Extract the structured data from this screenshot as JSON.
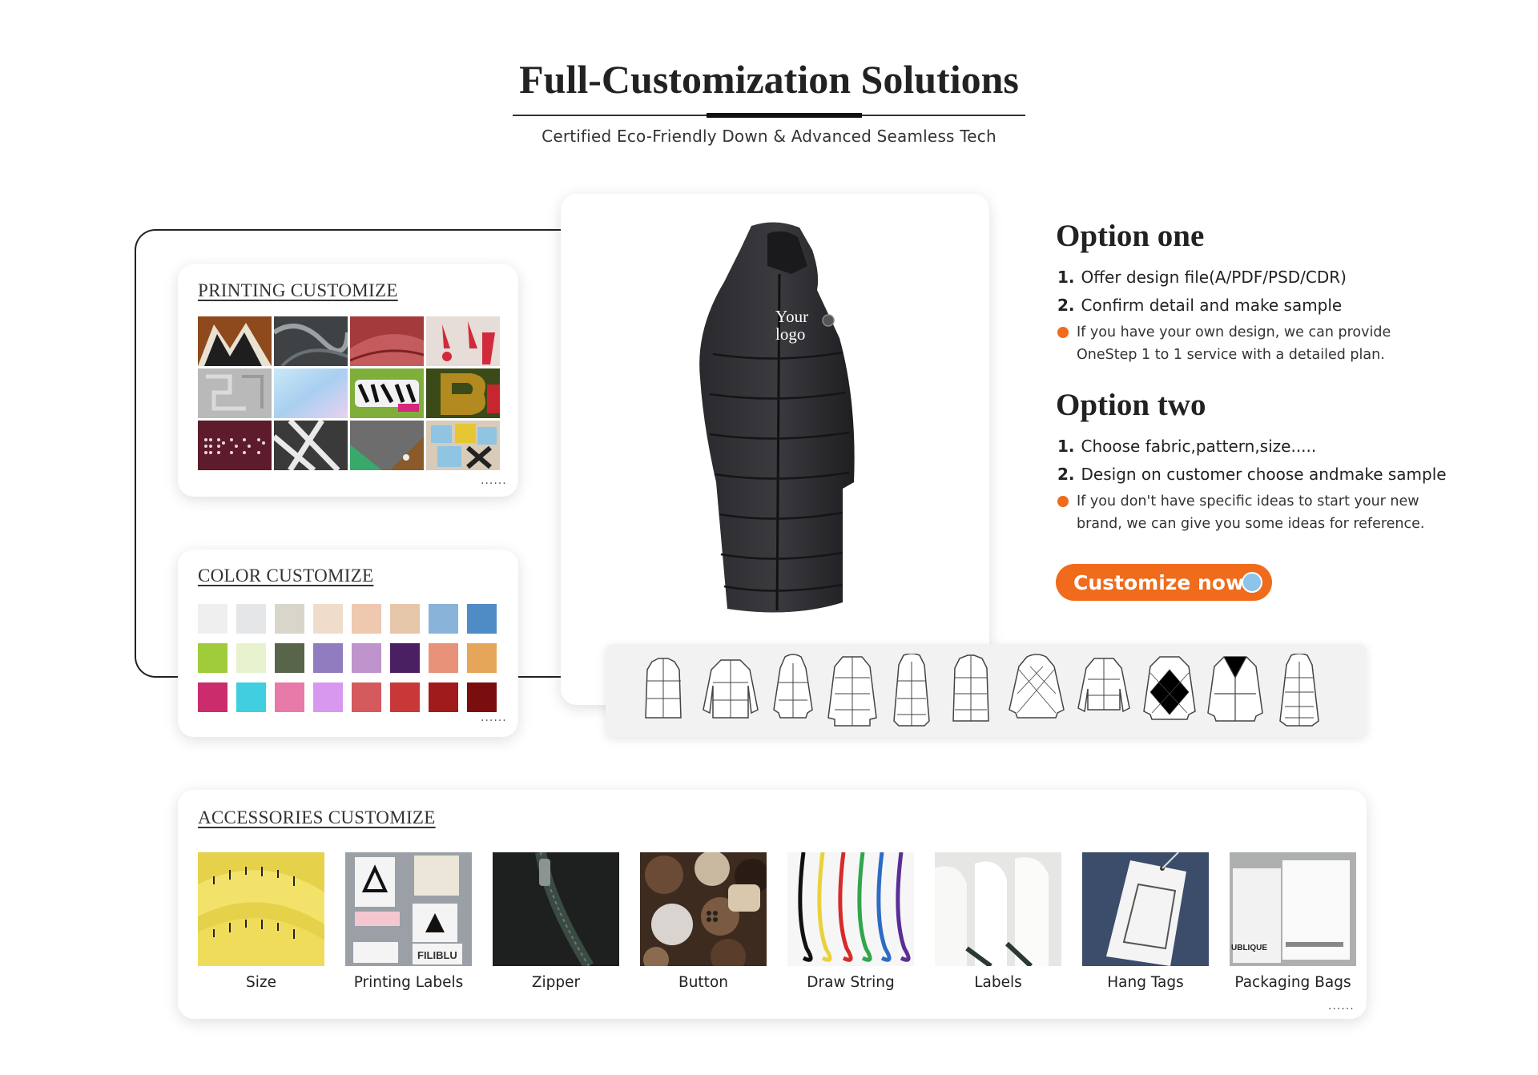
{
  "header": {
    "title": "Full-Customization Solutions",
    "subtitle": "Certified Eco-Friendly Down & Advanced Seamless Tech"
  },
  "printing": {
    "title": "PRINTING CUSTOMIZE",
    "more": "......",
    "tiles": [
      "#8e4a1c",
      "#3f4244",
      "#a33a3c",
      "#d8d0cc",
      "#b9b9b9",
      "#b7d6ef",
      "#7fae3b",
      "#3a4a18",
      "#5e1b2c",
      "#555",
      "#6f8f3e",
      "#8fc4e3"
    ]
  },
  "color": {
    "title": "COLOR CUSTOMIZE",
    "more": "......",
    "swatches": [
      "#efefef",
      "#e4e6e8",
      "#d8d6cb",
      "#f0dccb",
      "#efc8b0",
      "#e6c6a8",
      "#8ab3da",
      "#4f8bc5",
      "#a0cc3c",
      "#e8f2cf",
      "#58654a",
      "#917cc0",
      "#bf93cc",
      "#4b2062",
      "#e8927a",
      "#e6a65a",
      "#cb2c6b",
      "#40cfe1",
      "#e77aa8",
      "#d998ef",
      "#d55a5e",
      "#c83838",
      "#a01b1b",
      "#7a0d0d"
    ]
  },
  "product": {
    "logo_line1": "Your",
    "logo_line2": "logo"
  },
  "options": {
    "one": {
      "title": "Option one",
      "step1_num": "1.",
      "step1": "Offer design file(A/PDF/PSD/CDR)",
      "step2_num": "2.",
      "step2": "Confirm detail and make sample",
      "note": "If you have your own design, we can provide OneStep 1 to 1 service with a detailed plan."
    },
    "two": {
      "title": "Option two",
      "step1_num": "1.",
      "step1": "Choose fabric,pattern,size.....",
      "step2_num": "2.",
      "step2": "Design on customer choose andmake sample",
      "note": "If you don't have specific ideas to start your new brand, we can give you some ideas for reference."
    },
    "accent": "#f06b1b"
  },
  "cta": {
    "label": "Customize now"
  },
  "accessories": {
    "title": "ACCESSORIES CUSTOMIZE",
    "more": "......",
    "items": [
      {
        "label": "Size"
      },
      {
        "label": "Printing Labels",
        "tag_text": "FILIBLU"
      },
      {
        "label": "Zipper"
      },
      {
        "label": "Button"
      },
      {
        "label": "Draw String"
      },
      {
        "label": "Labels"
      },
      {
        "label": "Hang Tags"
      },
      {
        "label": "Packaging Bags",
        "tag_text": "UBLIQUE"
      }
    ]
  }
}
